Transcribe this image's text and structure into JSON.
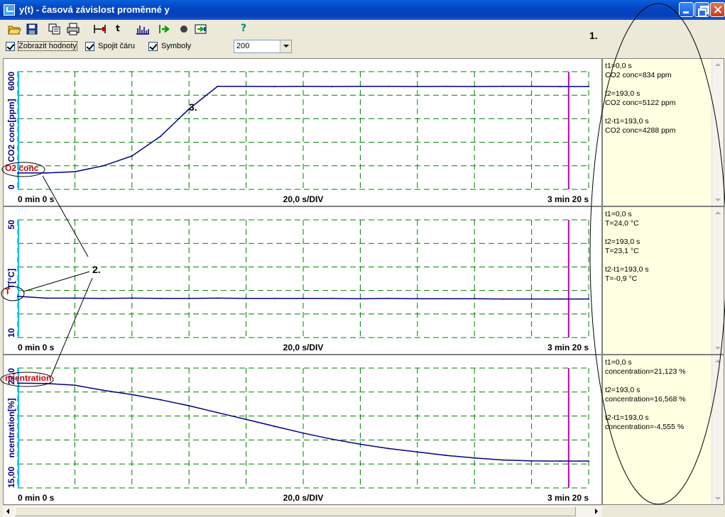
{
  "window": {
    "title": "y(t) - časová závislost proměnné y"
  },
  "toolbar": {
    "buttons": [
      "open-icon",
      "save-icon",
      "copy-icon",
      "print-icon",
      "cursor-marker-icon",
      "time-text",
      "spectrum-icon",
      "go-arrow-icon",
      "record-dot-icon",
      "export-icon",
      "help-icon"
    ],
    "t_label": "t",
    "help_label": "?"
  },
  "options": {
    "show_values_label": "Zobrazit hodnoty",
    "connect_line_label": "Spojit čáru",
    "symbols_label": "Symboly",
    "points_select_value": "200",
    "show_values_checked": true,
    "connect_line_checked": true,
    "symbols_checked": true
  },
  "colors": {
    "grid": "#008000",
    "data_line": "#000080",
    "cursor_start": "#00c0ff",
    "cursor_end": "#c000c0",
    "axis_label": "#000080",
    "channel_label": "#cc0000",
    "info_bg": "#ffffe1"
  },
  "annotations": {
    "one": "1.",
    "two": "2.",
    "three": "3."
  },
  "chart_data": [
    {
      "type": "line",
      "title": "",
      "channel_label": "O2 conc",
      "ylabel": "CO2 conc[ppm]",
      "ytick_labels": [
        "0",
        "6000"
      ],
      "ylim": [
        0,
        6000
      ],
      "xlim": [
        0,
        200
      ],
      "x_start_label": "0 min 0 s",
      "x_div_label": "20,0 s/DIV",
      "x_end_label": "3 min 20 s",
      "cursor1_x": 0,
      "cursor2_x": 193,
      "x": [
        0,
        10,
        20,
        30,
        40,
        50,
        60,
        70,
        80,
        90,
        100,
        110,
        120,
        130,
        140,
        150,
        160,
        170,
        180,
        190,
        200
      ],
      "values": [
        834,
        834,
        900,
        1200,
        1700,
        2700,
        4100,
        5250,
        5250,
        5240,
        5250,
        5240,
        5250,
        5250,
        5240,
        5250,
        5240,
        5250,
        5250,
        5240,
        5240
      ],
      "info": [
        "t1=0,0 s",
        "CO2 conc=834 ppm",
        "",
        "t2=193,0 s",
        "CO2 conc=5122 ppm",
        "",
        "t2-t1=193,0 s",
        "CO2 conc=4288 ppm"
      ]
    },
    {
      "type": "line",
      "title": "",
      "channel_label": "T",
      "ylabel": "T[°C]",
      "ytick_labels": [
        "10",
        "50"
      ],
      "ylim": [
        10,
        50
      ],
      "xlim": [
        0,
        200
      ],
      "x_start_label": "0 min 0 s",
      "x_div_label": "20,0 s/DIV",
      "x_end_label": "3 min 20 s",
      "cursor1_x": 0,
      "cursor2_x": 193,
      "x": [
        0,
        10,
        20,
        30,
        40,
        50,
        60,
        70,
        80,
        90,
        100,
        110,
        120,
        130,
        140,
        150,
        160,
        170,
        180,
        190,
        200
      ],
      "values": [
        24.0,
        23.4,
        23.4,
        23.3,
        23.4,
        23.3,
        23.3,
        23.4,
        23.3,
        23.3,
        23.3,
        23.3,
        23.2,
        23.3,
        23.2,
        23.2,
        23.2,
        23.1,
        23.1,
        23.1,
        23.1
      ],
      "info": [
        "t1=0,0 s",
        "T=24,0 °C",
        "",
        "t2=193,0 s",
        "T=23,1 °C",
        "",
        "t2-t1=193,0 s",
        "T=-0,9 °C"
      ]
    },
    {
      "type": "line",
      "title": "",
      "channel_label": "ncentration",
      "ylabel": "ncentration[%]",
      "ytick_labels": [
        "15,00",
        "22,0"
      ],
      "ylim": [
        15,
        22
      ],
      "xlim": [
        0,
        200
      ],
      "x_start_label": "0 min 0 s",
      "x_div_label": "20,0 s/DIV",
      "x_end_label": "3 min 20 s",
      "cursor1_x": 0,
      "cursor2_x": 193,
      "x": [
        0,
        10,
        20,
        30,
        40,
        50,
        60,
        70,
        80,
        90,
        100,
        110,
        120,
        130,
        140,
        150,
        160,
        170,
        180,
        190,
        200
      ],
      "values": [
        21.12,
        21.1,
        21.0,
        20.7,
        20.45,
        20.15,
        19.8,
        19.4,
        19.0,
        18.6,
        18.2,
        17.85,
        17.55,
        17.3,
        17.1,
        16.9,
        16.75,
        16.63,
        16.58,
        16.57,
        16.57
      ],
      "info": [
        "t1=0,0 s",
        "concentration=21,123 %",
        "",
        "t2=193,0 s",
        "concentration=16,568 %",
        "",
        "t2-t1=193,0 s",
        "concentration=-4,555 %"
      ]
    }
  ]
}
